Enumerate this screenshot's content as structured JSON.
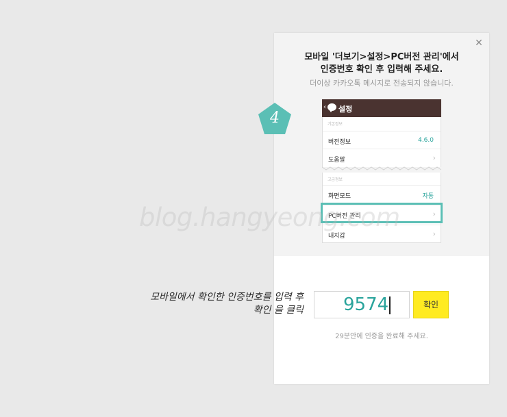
{
  "dialog": {
    "title_line1": "모바일 '더보기>설정>PC버전 관리'에서",
    "title_line2": "인증번호 확인 후 입력해 주세요.",
    "subtitle": "더이상 카카오톡 메시지로 전송되지 않습니다.",
    "close_icon": "close-icon"
  },
  "step": {
    "number": "4",
    "color": "#5bbfb5"
  },
  "phone": {
    "header_title": "설정",
    "header_color": "#4a3330",
    "section1": "기본정보",
    "rows1": [
      {
        "label": "버전정보",
        "value": "4.6.0"
      },
      {
        "label": "도움말"
      }
    ],
    "section2": "고급정보",
    "rows2": [
      {
        "label": "화면모드",
        "value": "자동"
      },
      {
        "label": "PC버전 관리"
      },
      {
        "label": "내지갑"
      }
    ]
  },
  "instruction_line1": "모바일에서 확인한 인증번호를 입력 후",
  "instruction_line2": "확인 을 클릭",
  "code_input_value": "9574",
  "confirm_button": "확인",
  "hint": "29분안에 인증을 완료해 주세요.",
  "watermark": "blog.hangyeong.com",
  "colors": {
    "accent": "#2aa49c",
    "button": "#ffeb21",
    "highlight": "#5bbfb5"
  }
}
